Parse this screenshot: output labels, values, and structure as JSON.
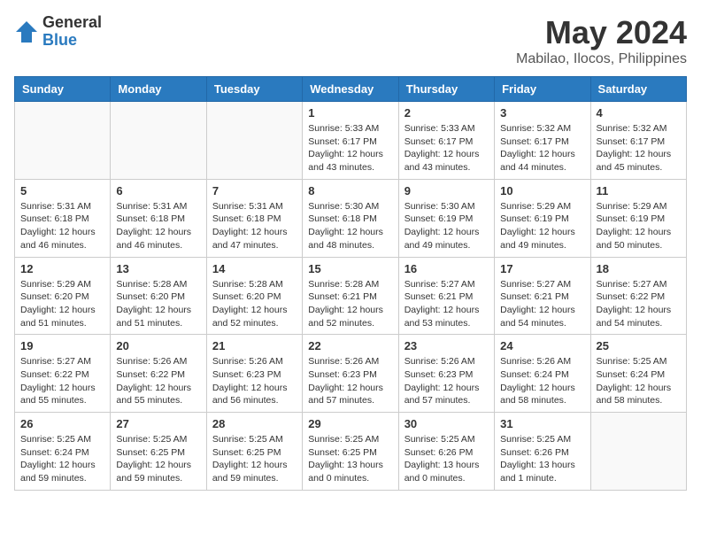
{
  "header": {
    "logo_general": "General",
    "logo_blue": "Blue",
    "month_year": "May 2024",
    "location": "Mabilao, Ilocos, Philippines"
  },
  "days_of_week": [
    "Sunday",
    "Monday",
    "Tuesday",
    "Wednesday",
    "Thursday",
    "Friday",
    "Saturday"
  ],
  "weeks": [
    [
      {
        "day": "",
        "info": ""
      },
      {
        "day": "",
        "info": ""
      },
      {
        "day": "",
        "info": ""
      },
      {
        "day": "1",
        "info": "Sunrise: 5:33 AM\nSunset: 6:17 PM\nDaylight: 12 hours\nand 43 minutes."
      },
      {
        "day": "2",
        "info": "Sunrise: 5:33 AM\nSunset: 6:17 PM\nDaylight: 12 hours\nand 43 minutes."
      },
      {
        "day": "3",
        "info": "Sunrise: 5:32 AM\nSunset: 6:17 PM\nDaylight: 12 hours\nand 44 minutes."
      },
      {
        "day": "4",
        "info": "Sunrise: 5:32 AM\nSunset: 6:17 PM\nDaylight: 12 hours\nand 45 minutes."
      }
    ],
    [
      {
        "day": "5",
        "info": "Sunrise: 5:31 AM\nSunset: 6:18 PM\nDaylight: 12 hours\nand 46 minutes."
      },
      {
        "day": "6",
        "info": "Sunrise: 5:31 AM\nSunset: 6:18 PM\nDaylight: 12 hours\nand 46 minutes."
      },
      {
        "day": "7",
        "info": "Sunrise: 5:31 AM\nSunset: 6:18 PM\nDaylight: 12 hours\nand 47 minutes."
      },
      {
        "day": "8",
        "info": "Sunrise: 5:30 AM\nSunset: 6:18 PM\nDaylight: 12 hours\nand 48 minutes."
      },
      {
        "day": "9",
        "info": "Sunrise: 5:30 AM\nSunset: 6:19 PM\nDaylight: 12 hours\nand 49 minutes."
      },
      {
        "day": "10",
        "info": "Sunrise: 5:29 AM\nSunset: 6:19 PM\nDaylight: 12 hours\nand 49 minutes."
      },
      {
        "day": "11",
        "info": "Sunrise: 5:29 AM\nSunset: 6:19 PM\nDaylight: 12 hours\nand 50 minutes."
      }
    ],
    [
      {
        "day": "12",
        "info": "Sunrise: 5:29 AM\nSunset: 6:20 PM\nDaylight: 12 hours\nand 51 minutes."
      },
      {
        "day": "13",
        "info": "Sunrise: 5:28 AM\nSunset: 6:20 PM\nDaylight: 12 hours\nand 51 minutes."
      },
      {
        "day": "14",
        "info": "Sunrise: 5:28 AM\nSunset: 6:20 PM\nDaylight: 12 hours\nand 52 minutes."
      },
      {
        "day": "15",
        "info": "Sunrise: 5:28 AM\nSunset: 6:21 PM\nDaylight: 12 hours\nand 52 minutes."
      },
      {
        "day": "16",
        "info": "Sunrise: 5:27 AM\nSunset: 6:21 PM\nDaylight: 12 hours\nand 53 minutes."
      },
      {
        "day": "17",
        "info": "Sunrise: 5:27 AM\nSunset: 6:21 PM\nDaylight: 12 hours\nand 54 minutes."
      },
      {
        "day": "18",
        "info": "Sunrise: 5:27 AM\nSunset: 6:22 PM\nDaylight: 12 hours\nand 54 minutes."
      }
    ],
    [
      {
        "day": "19",
        "info": "Sunrise: 5:27 AM\nSunset: 6:22 PM\nDaylight: 12 hours\nand 55 minutes."
      },
      {
        "day": "20",
        "info": "Sunrise: 5:26 AM\nSunset: 6:22 PM\nDaylight: 12 hours\nand 55 minutes."
      },
      {
        "day": "21",
        "info": "Sunrise: 5:26 AM\nSunset: 6:23 PM\nDaylight: 12 hours\nand 56 minutes."
      },
      {
        "day": "22",
        "info": "Sunrise: 5:26 AM\nSunset: 6:23 PM\nDaylight: 12 hours\nand 57 minutes."
      },
      {
        "day": "23",
        "info": "Sunrise: 5:26 AM\nSunset: 6:23 PM\nDaylight: 12 hours\nand 57 minutes."
      },
      {
        "day": "24",
        "info": "Sunrise: 5:26 AM\nSunset: 6:24 PM\nDaylight: 12 hours\nand 58 minutes."
      },
      {
        "day": "25",
        "info": "Sunrise: 5:25 AM\nSunset: 6:24 PM\nDaylight: 12 hours\nand 58 minutes."
      }
    ],
    [
      {
        "day": "26",
        "info": "Sunrise: 5:25 AM\nSunset: 6:24 PM\nDaylight: 12 hours\nand 59 minutes."
      },
      {
        "day": "27",
        "info": "Sunrise: 5:25 AM\nSunset: 6:25 PM\nDaylight: 12 hours\nand 59 minutes."
      },
      {
        "day": "28",
        "info": "Sunrise: 5:25 AM\nSunset: 6:25 PM\nDaylight: 12 hours\nand 59 minutes."
      },
      {
        "day": "29",
        "info": "Sunrise: 5:25 AM\nSunset: 6:25 PM\nDaylight: 13 hours\nand 0 minutes."
      },
      {
        "day": "30",
        "info": "Sunrise: 5:25 AM\nSunset: 6:26 PM\nDaylight: 13 hours\nand 0 minutes."
      },
      {
        "day": "31",
        "info": "Sunrise: 5:25 AM\nSunset: 6:26 PM\nDaylight: 13 hours\nand 1 minute."
      },
      {
        "day": "",
        "info": ""
      }
    ]
  ]
}
